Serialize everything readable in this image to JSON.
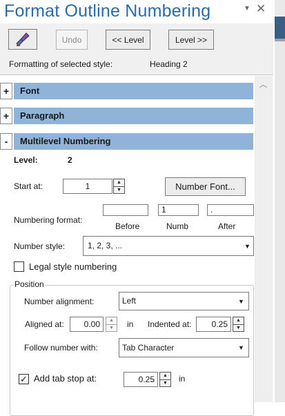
{
  "title": "Format Outline Numbering",
  "toolbar": {
    "undo_label": "Undo",
    "prev_level_label": "<< Level",
    "next_level_label": "Level >>"
  },
  "formatting": {
    "label": "Formatting of selected style:",
    "style": "Heading 2"
  },
  "sections": {
    "font": "Font",
    "paragraph": "Paragraph",
    "multilevel": "Multilevel Numbering"
  },
  "section_toggles": {
    "font": "+",
    "paragraph": "+",
    "multilevel": "-"
  },
  "level": {
    "label": "Level:",
    "value": "2"
  },
  "start_at": {
    "label": "Start at:",
    "value": "1"
  },
  "number_font_label": "Number Font...",
  "numbering_format": {
    "label": "Numbering format:",
    "before_value": "",
    "number_value": "1",
    "after_value": ".",
    "before_caption": "Before",
    "number_caption": "Numb",
    "after_caption": "After"
  },
  "number_style": {
    "label": "Number style:",
    "value": "1, 2, 3, ..."
  },
  "legal_style": {
    "label": "Legal style numbering",
    "checked": false
  },
  "position": {
    "group_label": "Position",
    "alignment_label": "Number alignment:",
    "alignment_value": "Left",
    "aligned_at_label": "Aligned at:",
    "aligned_at_value": "0.00",
    "aligned_unit": "in",
    "indented_at_label": "Indented at:",
    "indented_at_value": "0.25",
    "follow_label": "Follow number with:",
    "follow_value": "Tab Character",
    "tab_stop_label": "Add tab stop at:",
    "tab_stop_value": "0.25",
    "tab_stop_unit": "in",
    "tab_stop_checked": true
  },
  "colors": {
    "title": "#2b6aa8",
    "section_bar": "#8fb3d9",
    "panel": "#f0f0f0"
  }
}
